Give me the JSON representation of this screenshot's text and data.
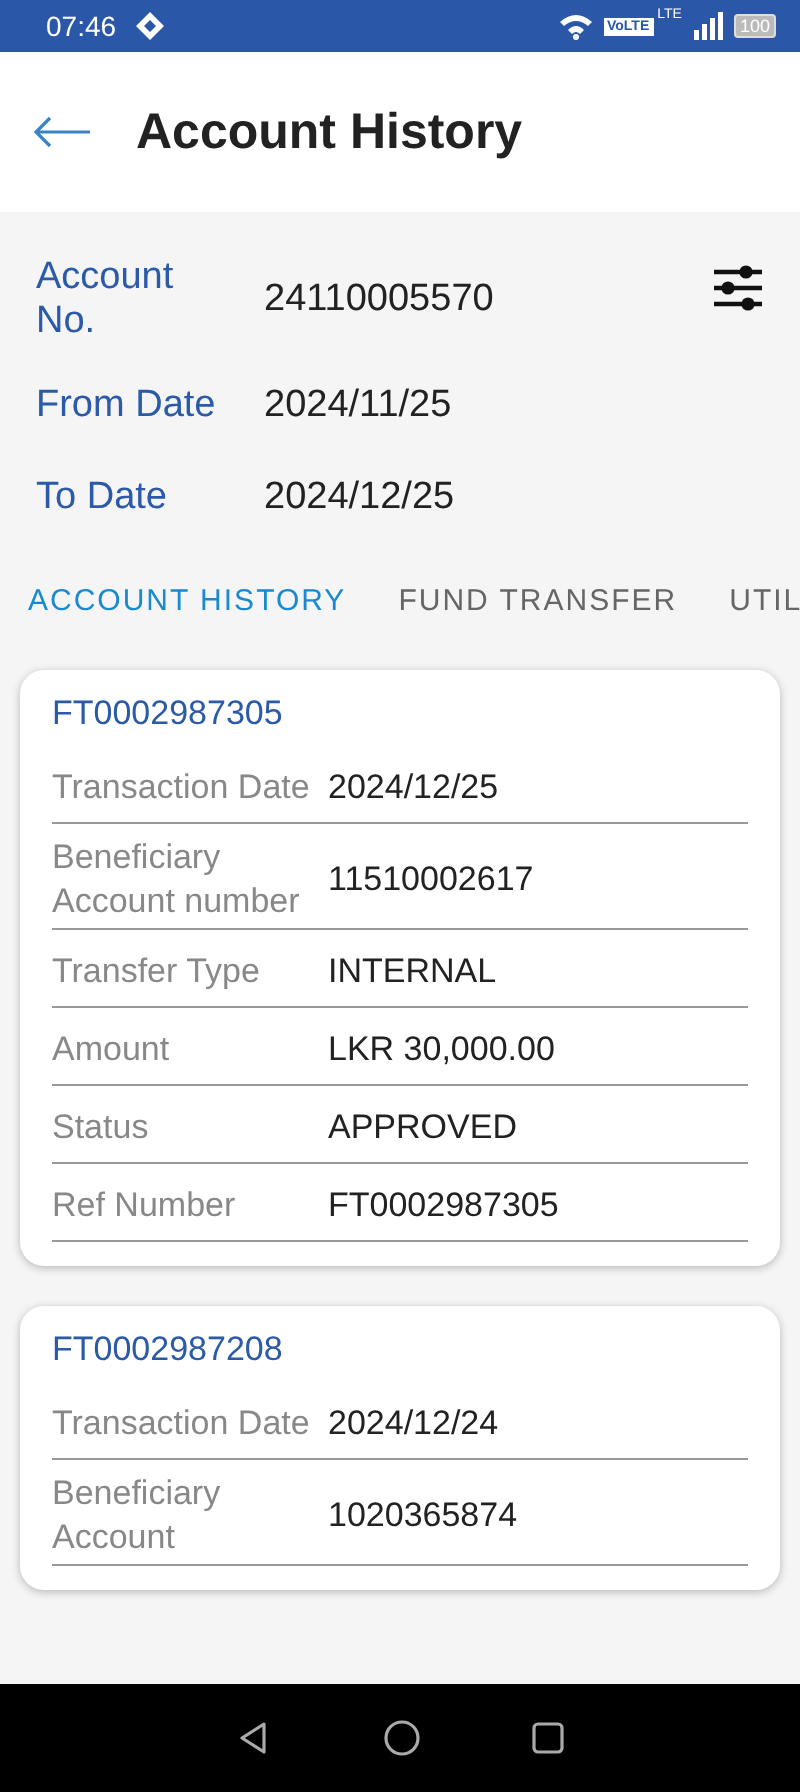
{
  "status_bar": {
    "time": "07:46",
    "volte": "VoLTE",
    "network": "LTE",
    "battery": "100"
  },
  "header": {
    "title": "Account History"
  },
  "account": [
    {
      "label": "Account No.",
      "value": "24110005570"
    },
    {
      "label": "From Date",
      "value": "2024/11/25"
    },
    {
      "label": "To Date",
      "value": "2024/12/25"
    }
  ],
  "tabs": [
    {
      "label": "ACCOUNT HISTORY",
      "selected": true
    },
    {
      "label": "FUND TRANSFER",
      "selected": false
    },
    {
      "label": "UTIL",
      "selected": false
    }
  ],
  "transactions": [
    {
      "title": "FT0002987305",
      "rows": [
        {
          "label": "Transaction Date",
          "value": "2024/12/25"
        },
        {
          "label": "Beneficiary Account number",
          "value": "11510002617"
        },
        {
          "label": "Transfer Type",
          "value": "INTERNAL"
        },
        {
          "label": "Amount",
          "value": "LKR 30,000.00"
        },
        {
          "label": "Status",
          "value": "APPROVED"
        },
        {
          "label": "Ref Number",
          "value": "FT0002987305"
        }
      ]
    },
    {
      "title": "FT0002987208",
      "rows": [
        {
          "label": "Transaction Date",
          "value": "2024/12/24"
        },
        {
          "label": "Beneficiary Account",
          "value": "1020365874"
        }
      ]
    }
  ]
}
